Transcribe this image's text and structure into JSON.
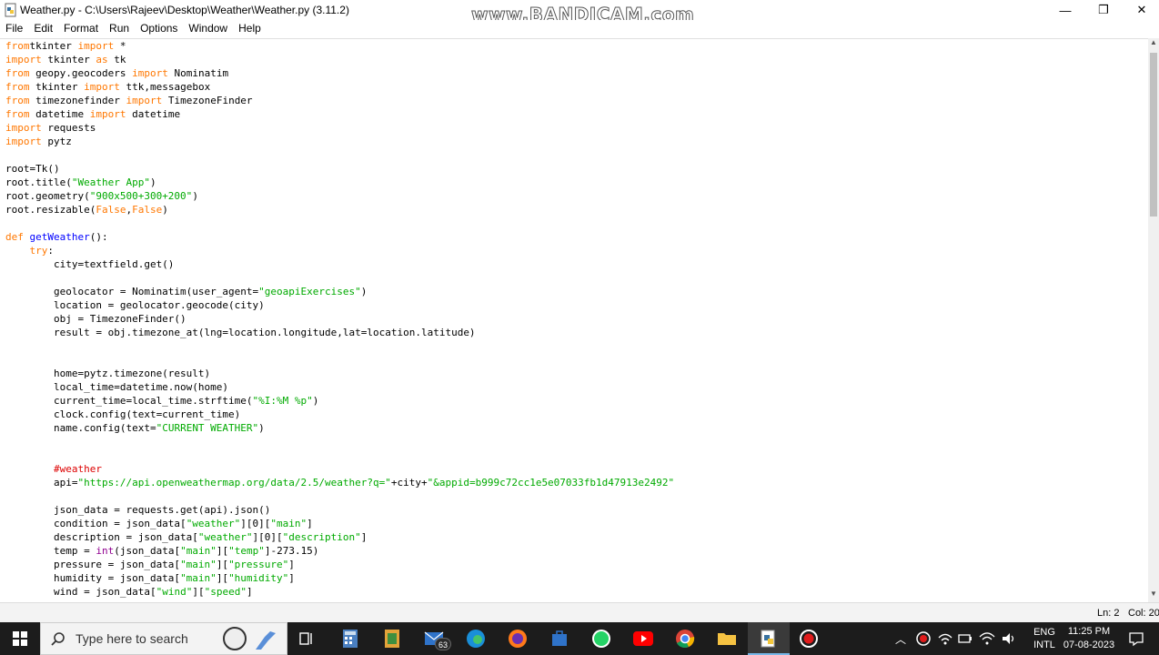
{
  "window": {
    "title": "Weather.py - C:\\Users\\Rajeev\\Desktop\\Weather\\Weather.py (3.11.2)",
    "watermark": "www.BANDICAM.com",
    "minimize_label": "—",
    "maximize_label": "❐",
    "close_label": "✕"
  },
  "menu": {
    "items": [
      "File",
      "Edit",
      "Format",
      "Run",
      "Options",
      "Window",
      "Help"
    ]
  },
  "editor": {
    "lines": [
      [
        [
          "kw",
          "from"
        ],
        [
          "",
          "tkinter "
        ],
        [
          "kw",
          "import"
        ],
        [
          "",
          " *"
        ]
      ],
      [
        [
          "kw",
          "import"
        ],
        [
          "",
          " tkinter "
        ],
        [
          "kw",
          "as"
        ],
        [
          "",
          " tk"
        ]
      ],
      [
        [
          "kw",
          "from"
        ],
        [
          "",
          " geopy.geocoders "
        ],
        [
          "kw",
          "import"
        ],
        [
          "",
          " Nominatim"
        ]
      ],
      [
        [
          "kw",
          "from"
        ],
        [
          "",
          " tkinter "
        ],
        [
          "kw",
          "import"
        ],
        [
          "",
          " ttk,messagebox"
        ]
      ],
      [
        [
          "kw",
          "from"
        ],
        [
          "",
          " timezonefinder "
        ],
        [
          "kw",
          "import"
        ],
        [
          "",
          " TimezoneFinder"
        ]
      ],
      [
        [
          "kw",
          "from"
        ],
        [
          "",
          " datetime "
        ],
        [
          "kw",
          "import"
        ],
        [
          "",
          " datetime"
        ]
      ],
      [
        [
          "kw",
          "import"
        ],
        [
          "",
          " requests"
        ]
      ],
      [
        [
          "kw",
          "import"
        ],
        [
          "",
          " pytz"
        ]
      ],
      [
        [
          "",
          ""
        ]
      ],
      [
        [
          "",
          "root=Tk()"
        ]
      ],
      [
        [
          "",
          "root.title("
        ],
        [
          "st",
          "\"Weather App\""
        ],
        [
          "",
          ")"
        ]
      ],
      [
        [
          "",
          "root.geometry("
        ],
        [
          "st",
          "\"900x500+300+200\""
        ],
        [
          "",
          ")"
        ]
      ],
      [
        [
          "",
          "root.resizable("
        ],
        [
          "kw",
          "False"
        ],
        [
          "",
          ","
        ],
        [
          "kw",
          "False"
        ],
        [
          "",
          ")"
        ]
      ],
      [
        [
          "",
          ""
        ]
      ],
      [
        [
          "kw",
          "def"
        ],
        [
          "",
          " "
        ],
        [
          "df",
          "getWeather"
        ],
        [
          "",
          "():"
        ]
      ],
      [
        [
          "",
          "    "
        ],
        [
          "kw",
          "try"
        ],
        [
          "",
          ":"
        ]
      ],
      [
        [
          "",
          "        city=textfield.get()"
        ]
      ],
      [
        [
          "",
          ""
        ]
      ],
      [
        [
          "",
          "        geolocator = Nominatim(user_agent="
        ],
        [
          "st",
          "\"geoapiExercises\""
        ],
        [
          "",
          ")"
        ]
      ],
      [
        [
          "",
          "        location = geolocator.geocode(city)"
        ]
      ],
      [
        [
          "",
          "        obj = TimezoneFinder()"
        ]
      ],
      [
        [
          "",
          "        result = obj.timezone_at(lng=location.longitude,lat=location.latitude)"
        ]
      ],
      [
        [
          "",
          ""
        ]
      ],
      [
        [
          "",
          ""
        ]
      ],
      [
        [
          "",
          "        home=pytz.timezone(result)"
        ]
      ],
      [
        [
          "",
          "        local_time=datetime.now(home)"
        ]
      ],
      [
        [
          "",
          "        current_time=local_time.strftime("
        ],
        [
          "st",
          "\"%I:%M %p\""
        ],
        [
          "",
          ")"
        ]
      ],
      [
        [
          "",
          "        clock.config(text=current_time)"
        ]
      ],
      [
        [
          "",
          "        name.config(text="
        ],
        [
          "st",
          "\"CURRENT WEATHER\""
        ],
        [
          "",
          ")"
        ]
      ],
      [
        [
          "",
          ""
        ]
      ],
      [
        [
          "",
          ""
        ]
      ],
      [
        [
          "",
          "        "
        ],
        [
          "cm",
          "#weather"
        ]
      ],
      [
        [
          "",
          "        api="
        ],
        [
          "st",
          "\"https://api.openweathermap.org/data/2.5/weather?q=\""
        ],
        [
          "",
          "+city+"
        ],
        [
          "st",
          "\"&appid=b999c72cc1e5e07033fb1d47913e2492\""
        ]
      ],
      [
        [
          "",
          ""
        ]
      ],
      [
        [
          "",
          "        json_data = requests.get(api).json()"
        ]
      ],
      [
        [
          "",
          "        condition = json_data["
        ],
        [
          "st",
          "\"weather\""
        ],
        [
          "",
          "][0]["
        ],
        [
          "st",
          "\"main\""
        ],
        [
          "",
          "]"
        ]
      ],
      [
        [
          "",
          "        description = json_data["
        ],
        [
          "st",
          "\"weather\""
        ],
        [
          "",
          "][0]["
        ],
        [
          "st",
          "\"description\""
        ],
        [
          "",
          "]"
        ]
      ],
      [
        [
          "",
          "        temp = "
        ],
        [
          "bi",
          "int"
        ],
        [
          "",
          "(json_data["
        ],
        [
          "st",
          "\"main\""
        ],
        [
          "",
          "]["
        ],
        [
          "st",
          "\"temp\""
        ],
        [
          "",
          "]-273.15)"
        ]
      ],
      [
        [
          "",
          "        pressure = json_data["
        ],
        [
          "st",
          "\"main\""
        ],
        [
          "",
          "]["
        ],
        [
          "st",
          "\"pressure\""
        ],
        [
          "",
          "]"
        ]
      ],
      [
        [
          "",
          "        humidity = json_data["
        ],
        [
          "st",
          "\"main\""
        ],
        [
          "",
          "]["
        ],
        [
          "st",
          "\"humidity\""
        ],
        [
          "",
          "]"
        ]
      ],
      [
        [
          "",
          "        wind = json_data["
        ],
        [
          "st",
          "\"wind\""
        ],
        [
          "",
          "]["
        ],
        [
          "st",
          "\"speed\""
        ],
        [
          "",
          "]"
        ]
      ]
    ]
  },
  "statusbar": {
    "line": "Ln: 2",
    "col": "Col: 20"
  },
  "taskbar": {
    "search_placeholder": "Type here to search",
    "mail_badge": "63",
    "language_top": "ENG",
    "language_bottom": "INTL",
    "time": "11:25 PM",
    "date": "07-08-2023",
    "icons": [
      "task-view-icon",
      "calculator-icon",
      "notepad-icon",
      "mail-icon",
      "edge-icon",
      "firefox-icon",
      "store-icon",
      "whatsapp-icon",
      "youtube-icon",
      "chrome-icon",
      "file-explorer-icon",
      "python-idle-icon",
      "bandicam-record-icon"
    ]
  }
}
